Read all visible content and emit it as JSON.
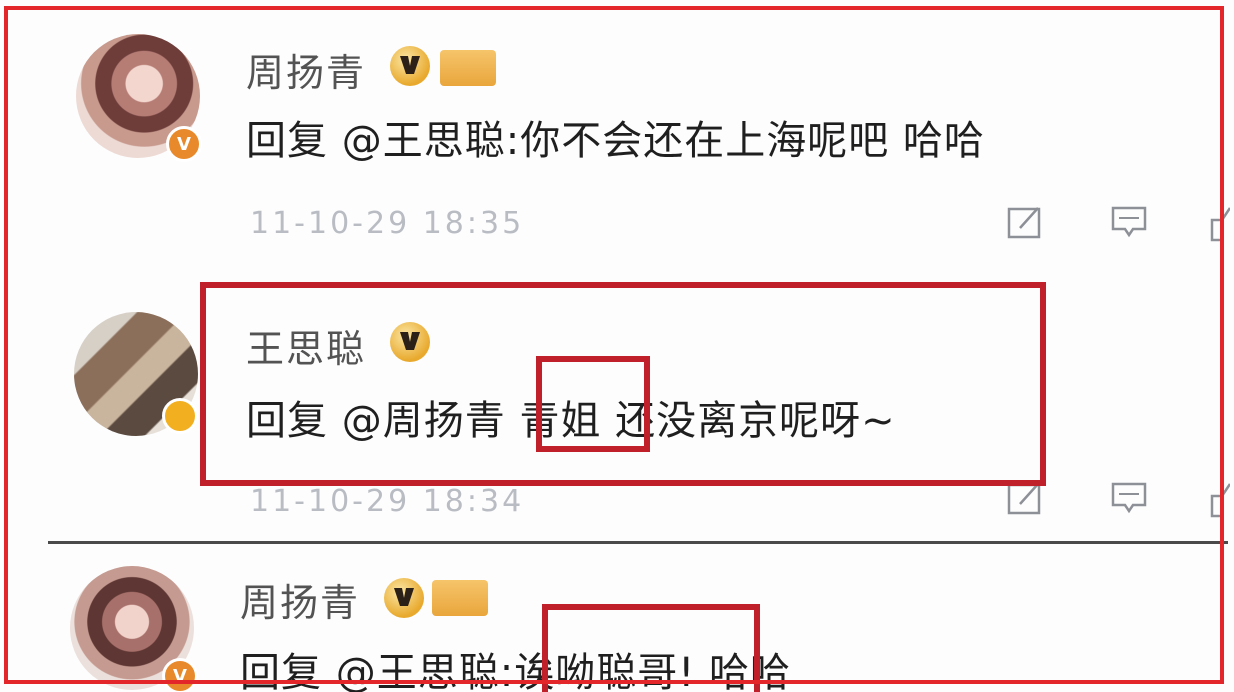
{
  "comments": [
    {
      "username": "周扬青",
      "text": "回复 @王思聪:你不会还在上海呢吧 哈哈",
      "timestamp": "11-10-29 18:35",
      "avatar_badge": "V"
    },
    {
      "username": "王思聪",
      "text_prefix": "回复 @周扬青 ",
      "text_highlight": "青姐",
      "text_suffix": " 还没离京呢呀~",
      "timestamp": "11-10-29 18:34"
    },
    {
      "username": "周扬青",
      "text_prefix": "回复 @王思聪:",
      "text_highlight": "诶呦聪哥!",
      "text_suffix": " 哈哈",
      "avatar_badge": "V"
    }
  ],
  "icons": {
    "vip": "vip-crown-icon",
    "level": "level-tag-icon",
    "edit": "edit-icon",
    "reply": "comment-icon",
    "like": "like-icon"
  },
  "colors": {
    "highlight_border": "#c0202a",
    "outer_border": "#e2262a",
    "username": "#535353",
    "timestamp": "#b9bcc3"
  }
}
